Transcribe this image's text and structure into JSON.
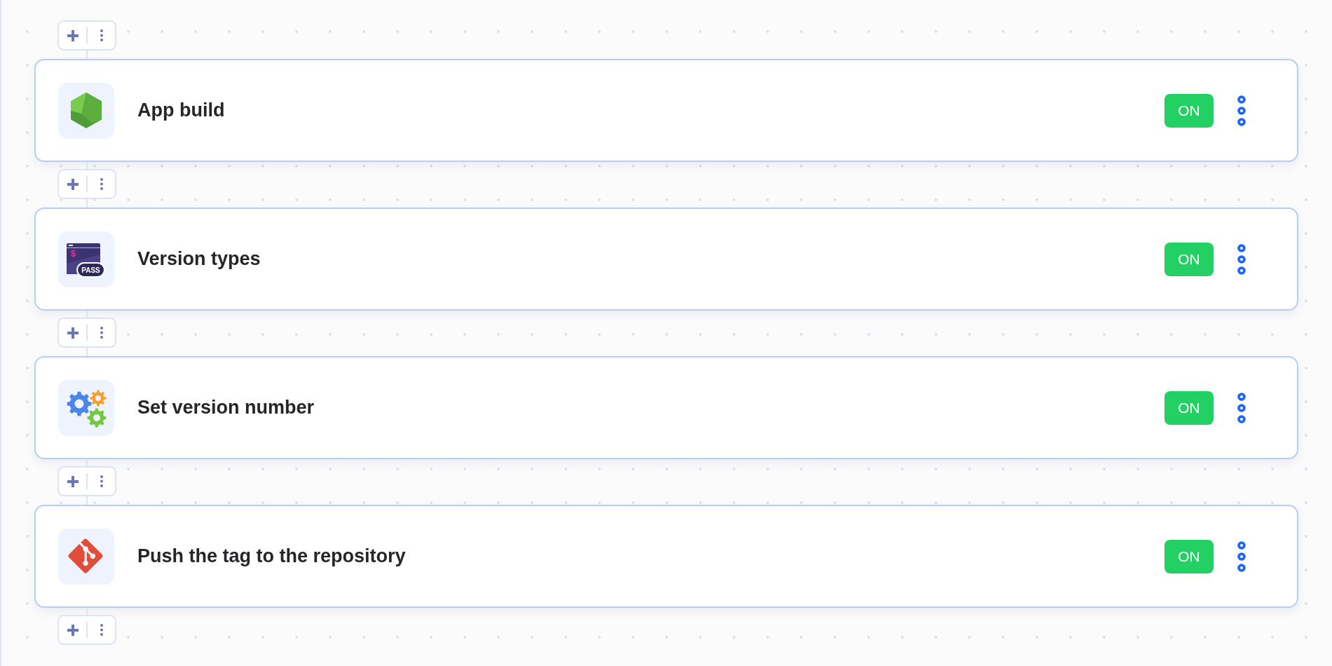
{
  "steps": [
    {
      "title": "App build",
      "status": "ON",
      "on": true
    },
    {
      "title": "Version types",
      "status": "ON",
      "on": true,
      "icon_symbol": "$",
      "icon_badge": "PASS"
    },
    {
      "title": "Set version number",
      "status": "ON",
      "on": true
    },
    {
      "title": "Push the tag to the repository",
      "status": "ON",
      "on": true
    }
  ]
}
